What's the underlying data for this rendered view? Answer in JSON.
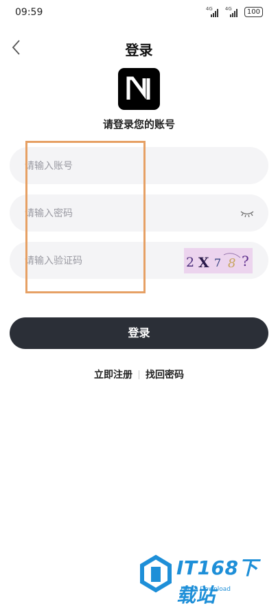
{
  "status_bar": {
    "time": "09:59",
    "network_1": "4G",
    "network_2": "4G",
    "battery": "100"
  },
  "header": {
    "title": "登录"
  },
  "logo": {
    "caption": "请登录您的账号"
  },
  "form": {
    "account_placeholder": "请输入账号",
    "password_placeholder": "请输入密码",
    "captcha_placeholder": "请输入验证码",
    "captcha_chars": [
      "2",
      "X",
      "7",
      "8",
      "?"
    ]
  },
  "actions": {
    "login_label": "登录",
    "register_label": "立即注册",
    "recover_label": "找回密码"
  },
  "watermark": {
    "brand": "IT168下载站",
    "sub": "IT168 Download"
  },
  "colors": {
    "highlight": "#e6a064",
    "button": "#2b2f37",
    "watermark": "#1e8fd8"
  }
}
